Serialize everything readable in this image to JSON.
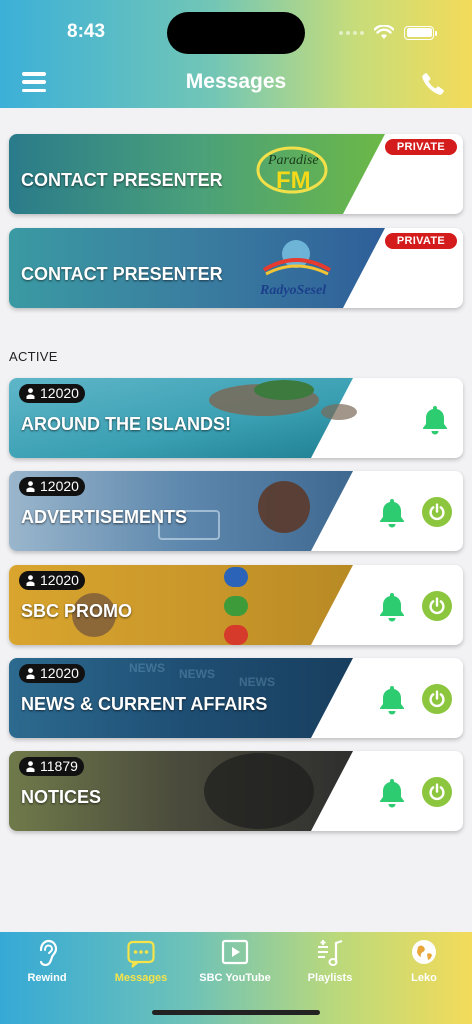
{
  "status_bar": {
    "time": "8:43"
  },
  "header": {
    "title": "Messages"
  },
  "private_cards": [
    {
      "label": "CONTACT PRESENTER",
      "badge": "PRIVATE",
      "logo": "Paradise FM logo"
    },
    {
      "label": "CONTACT PRESENTER",
      "badge": "PRIVATE",
      "logo": "Radyo Sesel"
    }
  ],
  "section_title": "ACTIVE",
  "channels": [
    {
      "label": "AROUND THE ISLANDS!",
      "count": "12020",
      "has_power": false
    },
    {
      "label": "ADVERTISEMENTS",
      "count": "12020",
      "has_power": true
    },
    {
      "label": "SBC PROMO",
      "count": "12020",
      "has_power": true
    },
    {
      "label": "NEWS & CURRENT AFFAIRS",
      "count": "12020",
      "has_power": true
    },
    {
      "label": "NOTICES",
      "count": "11879",
      "has_power": true
    }
  ],
  "tabs": [
    {
      "label": "Rewind",
      "icon": "ear-icon"
    },
    {
      "label": "Messages",
      "icon": "chat-icon",
      "active": true
    },
    {
      "label": "SBC YouTube",
      "icon": "play-icon"
    },
    {
      "label": "Playlists",
      "icon": "playlist-icon"
    },
    {
      "label": "Leko",
      "icon": "globe-icon"
    }
  ],
  "colors": {
    "accent_green": "#2ecc71",
    "power_green": "#8cc63f",
    "badge_red": "#d51c1c",
    "active_tab": "#f7e34a"
  }
}
